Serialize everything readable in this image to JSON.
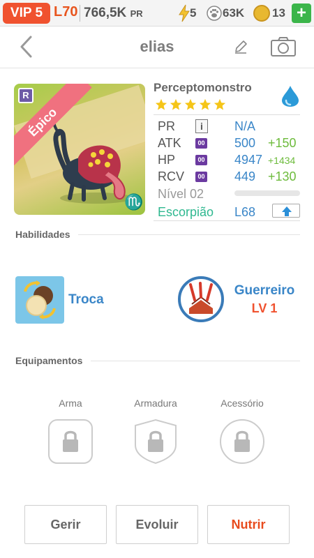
{
  "status_bar": {
    "vip": "VIP 5",
    "level": "L70",
    "power": "766,5K",
    "power_unit": "PR",
    "energy": "5",
    "paw": "63K",
    "coins": "13",
    "add_label": "+"
  },
  "header": {
    "title": "elias"
  },
  "monster": {
    "name": "Perceptomonstro",
    "rarity_badge": "R",
    "rarity": "Épico",
    "stars": 5,
    "element_icon": "water-drop-icon",
    "zodiac_symbol": "♏",
    "stats": {
      "pr": {
        "label": "PR",
        "value": "N/A"
      },
      "atk": {
        "label": "ATK",
        "badge": "00",
        "value": "500",
        "bonus": "+150"
      },
      "hp": {
        "label": "HP",
        "badge": "00",
        "value": "4947",
        "bonus": "+1434"
      },
      "rcv": {
        "label": "RCV",
        "badge": "00",
        "value": "449",
        "bonus": "+130"
      }
    },
    "level_text": "Nível 02",
    "xp_fraction": 0,
    "sign": "Escorpião",
    "sign_level": "L68"
  },
  "skills": {
    "title": "Habilidades",
    "skill_a": {
      "label": "Troca"
    },
    "skill_b": {
      "label": "Guerreiro",
      "level": "LV 1"
    }
  },
  "equipment": {
    "title": "Equipamentos",
    "slots": [
      {
        "label": "Arma"
      },
      {
        "label": "Armadura"
      },
      {
        "label": "Acessório"
      }
    ]
  },
  "actions": {
    "manage": "Gerir",
    "evolve": "Evoluir",
    "feed": "Nutrir"
  },
  "colors": {
    "accent_orange": "#f0522f",
    "stat_blue": "#3a86c8",
    "bonus_green": "#6dbb3c",
    "sign_teal": "#2fb890",
    "plus_green": "#3bb54a"
  }
}
